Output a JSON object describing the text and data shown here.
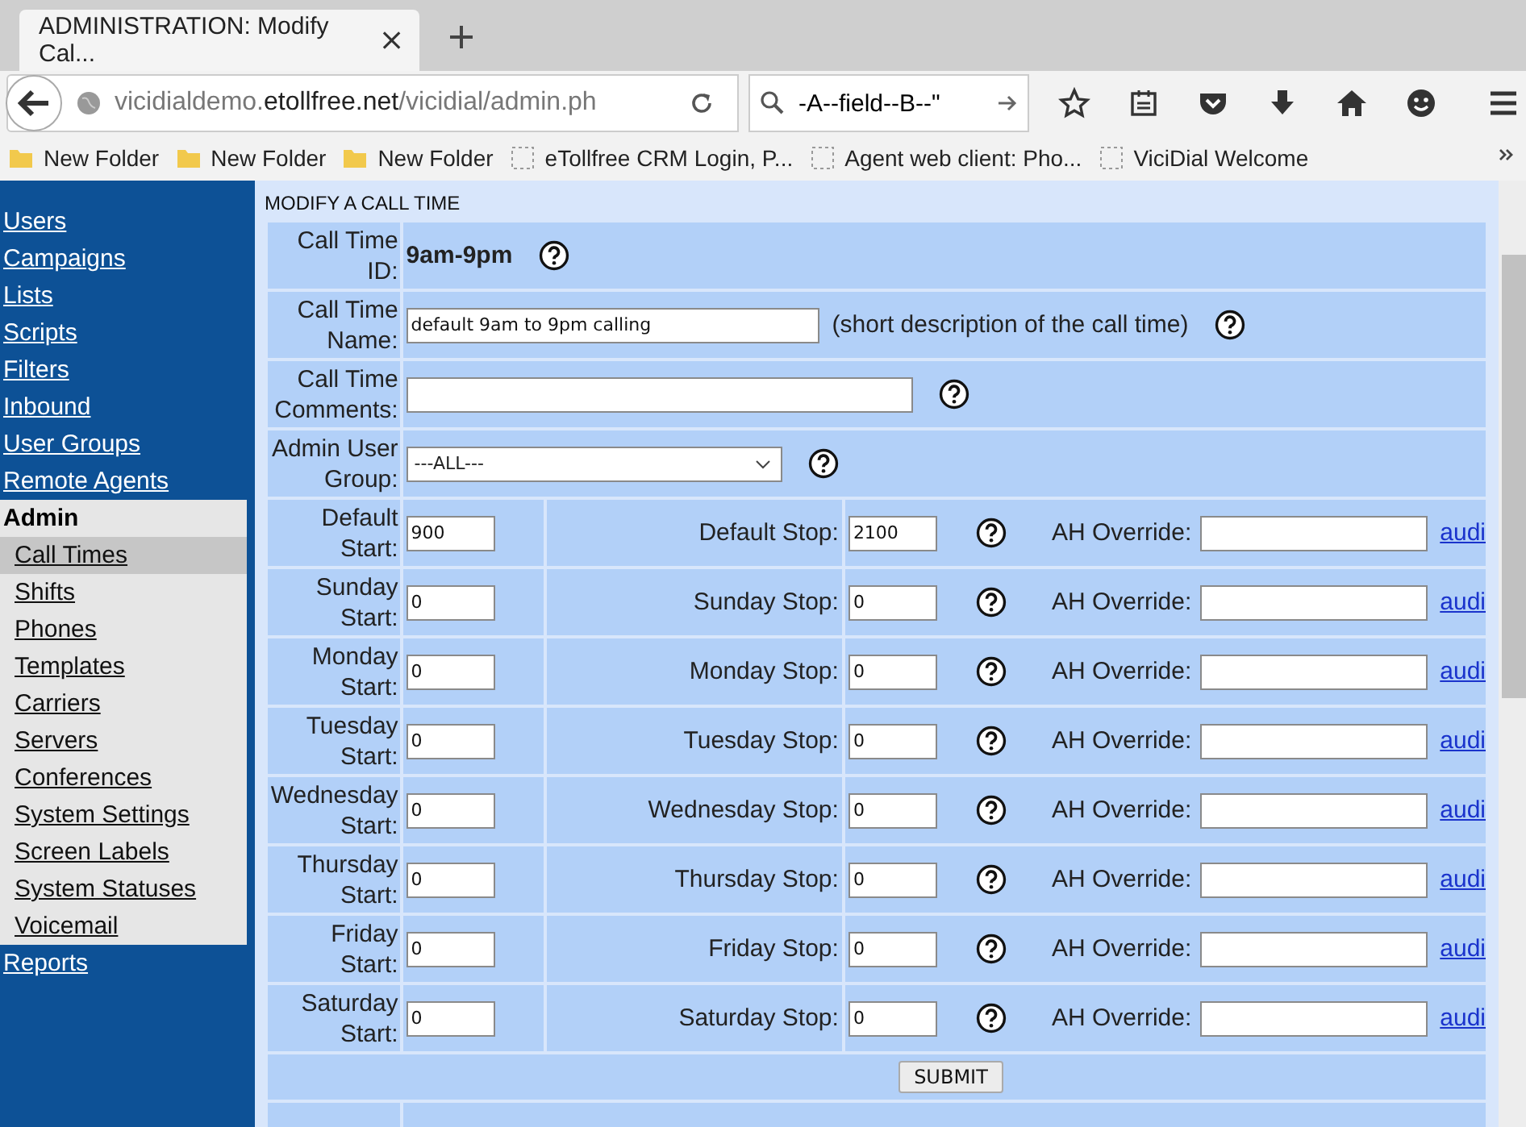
{
  "browser": {
    "tab": {
      "title": "ADMINISTRATION: Modify Cal..."
    },
    "url": {
      "prefix": "vicidialdemo.",
      "domain": "etollfree.net",
      "path": "/vicidial/admin.ph"
    },
    "search": {
      "value": "-A--field--B--\""
    },
    "bookmarks": [
      {
        "kind": "folder",
        "label": "New Folder"
      },
      {
        "kind": "folder",
        "label": "New Folder"
      },
      {
        "kind": "folder",
        "label": "New Folder"
      },
      {
        "kind": "page",
        "label": "eTollfree CRM Login, P..."
      },
      {
        "kind": "page",
        "label": "Agent web client: Pho..."
      },
      {
        "kind": "page",
        "label": "ViciDial Welcome"
      }
    ]
  },
  "sidebar": {
    "items": [
      {
        "label": "Users"
      },
      {
        "label": "Campaigns"
      },
      {
        "label": "Lists"
      },
      {
        "label": "Scripts"
      },
      {
        "label": "Filters"
      },
      {
        "label": "Inbound"
      },
      {
        "label": "User Groups"
      },
      {
        "label": "Remote Agents"
      },
      {
        "label": "Admin",
        "children": [
          {
            "label": "Call Times",
            "selected": true
          },
          {
            "label": "Shifts",
            "selected": false
          },
          {
            "label": "Phones",
            "selected": false
          },
          {
            "label": "Templates",
            "selected": false
          },
          {
            "label": "Carriers",
            "selected": false
          },
          {
            "label": "Servers",
            "selected": false
          },
          {
            "label": "Conferences",
            "selected": false
          },
          {
            "label": "System Settings",
            "selected": false
          },
          {
            "label": "Screen Labels",
            "selected": false
          },
          {
            "label": "System Statuses",
            "selected": false
          },
          {
            "label": "Voicemail",
            "selected": false
          }
        ]
      },
      {
        "label": "Reports"
      }
    ]
  },
  "form": {
    "title": "MODIFY A CALL TIME",
    "fields": [
      {
        "kind": "static",
        "label": "Call Time ID:",
        "value": "9am-9pm"
      },
      {
        "kind": "input",
        "label": "Call Time Name:",
        "value": "default 9am to 9pm calling",
        "note": "(short description of the call time)"
      },
      {
        "kind": "wide",
        "label": "Call Time Comments:"
      },
      {
        "kind": "select",
        "label": "Admin User Group:",
        "value": "---ALL---"
      }
    ],
    "schedule": [
      {
        "start_label": "Default Start:",
        "start": "900",
        "stop_label": "Default Stop:",
        "stop": "2100",
        "override_label": "AH Override:",
        "link": "audi"
      },
      {
        "start_label": "Sunday Start:",
        "start": "0",
        "stop_label": "Sunday Stop:",
        "stop": "0",
        "override_label": "AH Override:",
        "link": "audi"
      },
      {
        "start_label": "Monday Start:",
        "start": "0",
        "stop_label": "Monday Stop:",
        "stop": "0",
        "override_label": "AH Override:",
        "link": "audi"
      },
      {
        "start_label": "Tuesday Start:",
        "start": "0",
        "stop_label": "Tuesday Stop:",
        "stop": "0",
        "override_label": "AH Override:",
        "link": "audi"
      },
      {
        "start_label": "Wednesday Start:",
        "start": "0",
        "stop_label": "Wednesday Stop:",
        "stop": "0",
        "override_label": "AH Override:",
        "link": "audi"
      },
      {
        "start_label": "Thursday Start:",
        "start": "0",
        "stop_label": "Thursday Stop:",
        "stop": "0",
        "override_label": "AH Override:",
        "link": "audi"
      },
      {
        "start_label": "Friday Start:",
        "start": "0",
        "stop_label": "Friday Stop:",
        "stop": "0",
        "override_label": "AH Override:",
        "link": "audi"
      },
      {
        "start_label": "Saturday Start:",
        "start": "0",
        "stop_label": "Saturday Stop:",
        "stop": "0",
        "override_label": "AH Override:",
        "link": "audi"
      }
    ],
    "submit": "SUBMIT"
  }
}
